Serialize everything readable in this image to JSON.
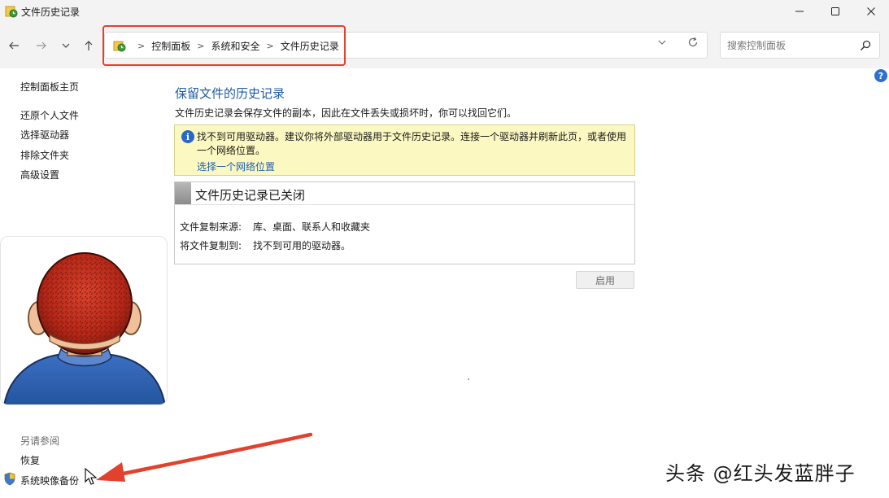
{
  "window": {
    "title": "文件历史记录"
  },
  "address": {
    "crumbs": [
      "控制面板",
      "系统和安全",
      "文件历史记录"
    ]
  },
  "search": {
    "placeholder": "搜索控制面板"
  },
  "left_nav": {
    "home": "控制面板主页",
    "items": [
      "还原个人文件",
      "选择驱动器",
      "排除文件夹",
      "高级设置"
    ],
    "see_also_label": "另请参阅",
    "see_also": [
      "恢复",
      "系统映像备份"
    ]
  },
  "main": {
    "title": "保留文件的历史记录",
    "description": "文件历史记录会保存文件的副本，因此在文件丢失或损坏时，你可以找回它们。",
    "warning": {
      "text": "找不到可用驱动器。建议你将外部驱动器用于文件历史记录。连接一个驱动器并刷新此页，或者使用一个网络位置。",
      "link": "选择一个网络位置"
    },
    "status": {
      "title": "文件历史记录已关闭",
      "rows": [
        {
          "label": "文件复制来源:",
          "value": "库、桌面、联系人和收藏夹"
        },
        {
          "label": "将文件复制到:",
          "value": "找不到可用的驱动器。"
        }
      ]
    },
    "enable_button": "启用"
  },
  "watermark": "头条 @红头发蓝胖子",
  "colors": {
    "accent_title": "#1e5aa0",
    "link": "#1a5fb4",
    "warning_bg": "#fcf8c2",
    "annotation_red": "#e2412d"
  }
}
